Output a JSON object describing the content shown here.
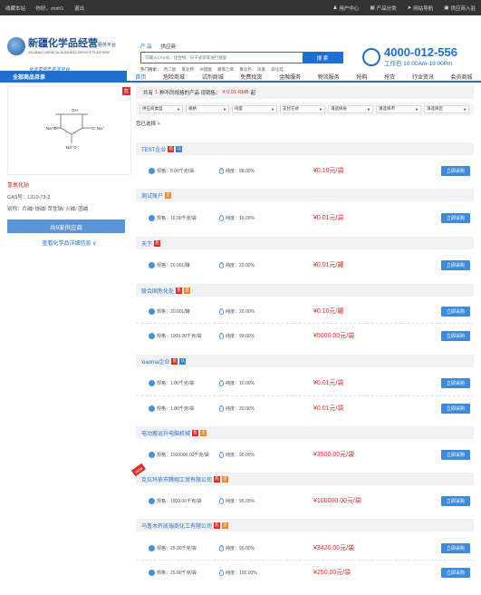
{
  "topbar": {
    "links": [
      "收藏本站",
      "你好，zxxh1",
      "退出"
    ],
    "right": [
      {
        "icon": "user-icon",
        "label": "用户中心"
      },
      {
        "icon": "grid-icon",
        "label": "产品分类"
      },
      {
        "icon": "send-icon",
        "label": "网站导航"
      },
      {
        "icon": "store-icon",
        "label": "供应商入驻"
      }
    ]
  },
  "logo": {
    "title": "新疆化学品经营",
    "title_suffix": "服务平台",
    "en": "XINJIANG CHEMICAL BUSINESS SERVICE PLATFORM",
    "slogan": "化天堂何吃的天平台"
  },
  "search": {
    "tabs": [
      "产 品",
      "供应商"
    ],
    "placeholder": "可输入CAS号、化合物、分子式等等进行搜索",
    "button": "搜 索",
    "hot_label": "热门搜索：",
    "hot": [
      "丙二醇",
      "氯化钾",
      "冰醋酸",
      "聚氯乙烯",
      "氯化钙",
      "尿素",
      "碳化硅"
    ]
  },
  "contact": {
    "phone": "4000-012-556",
    "hours": "工作日 10:00Am-19:00Pm"
  },
  "nav": {
    "all": "全部商品目录",
    "items": [
      "首页",
      "危险商城",
      "试剂商城",
      "免费找货",
      "金融服务",
      "物流服务",
      "抢购",
      "抢货",
      "行业资讯",
      "会员商城"
    ]
  },
  "product": {
    "badge": "危",
    "name": "氢氧化钠",
    "cas": "CAS号：1310-73-2",
    "alias": "别称：片碱/ 烧碱/ 苛性钠/ 火碱/ 固碱",
    "supplier_btn": "共9家供应商",
    "detail_link": "查看化学品详细信息 ∨"
  },
  "summary": {
    "prefix": "共有",
    "count": "1",
    "mid": "种不同规格的产品 现销售：",
    "price": "¥ 0.01 RMB",
    "suffix": "起"
  },
  "filters": [
    "供应商类型",
    "规格",
    "纯度",
    "支付方式",
    "请选择省",
    "请选择市",
    "请选择区"
  ],
  "selected_label": "您已选择 >",
  "suppliers": [
    {
      "name": "TEST企业",
      "tags": [
        "red",
        "blue"
      ]
    },
    {
      "name": "测试账户",
      "tags": [
        "orange"
      ]
    },
    {
      "name": "天下",
      "tags": [
        "red"
      ]
    },
    {
      "name": "联合国危化处",
      "tags": [
        "red",
        "orange"
      ]
    },
    {
      "name": "xiaoma企业",
      "tags": [
        "red",
        "blue"
      ]
    },
    {
      "name": "电动搬运升电脑机械",
      "tags": [
        "red",
        "orange"
      ]
    },
    {
      "name": "克拉玛依市腾翔工贸有限公司",
      "tags": [
        "red",
        "orange"
      ]
    },
    {
      "name": "乌鲁木齐凯瑞商化工有限公司",
      "tags": [
        "red",
        "orange"
      ]
    }
  ],
  "offers": [
    {
      "spec": "规格：5.00千克/袋",
      "purity": "纯度：88.00%",
      "price": "¥0.10元/袋"
    },
    {
      "spec": "规格：10.00千克/袋",
      "purity": "纯度：10.00%",
      "price": "¥0.01元/袋"
    },
    {
      "spec": "规格：20.00L/罐",
      "purity": "纯度：20.00%",
      "price": "¥0.01元/罐"
    },
    {
      "spec": "规格：20.00L/罐",
      "purity": "纯度：20.00%",
      "price": "¥0.10元/罐"
    },
    {
      "spec": "规格：1000.00千克/袋",
      "purity": "纯度：99.00%",
      "price": "¥5000.00元/袋"
    },
    {
      "spec": "规格：1.00千克/袋",
      "purity": "纯度：10.00%",
      "price": "¥0.01元/袋"
    },
    {
      "spec": "规格：1.00千克/袋",
      "purity": "纯度：20.00%",
      "price": "¥0.01元/袋"
    },
    {
      "spec": "规格：1000000.00千克/袋",
      "purity": "纯度：95.00%",
      "price": "¥3500.00元/袋"
    },
    {
      "spec": "规格：1000.00千克/袋",
      "purity": "纯度：95.00%",
      "price": "¥100000.00元/袋"
    },
    {
      "spec": "规格：25.00千克/袋",
      "purity": "纯度：95.00%",
      "price": "¥3420.00元/袋"
    },
    {
      "spec": "规格：25.00千克/袋",
      "purity": "纯度：100.00%",
      "price": "¥250.00元/袋"
    }
  ],
  "buy_label": "立即采购",
  "new_ribbon": "NEW"
}
